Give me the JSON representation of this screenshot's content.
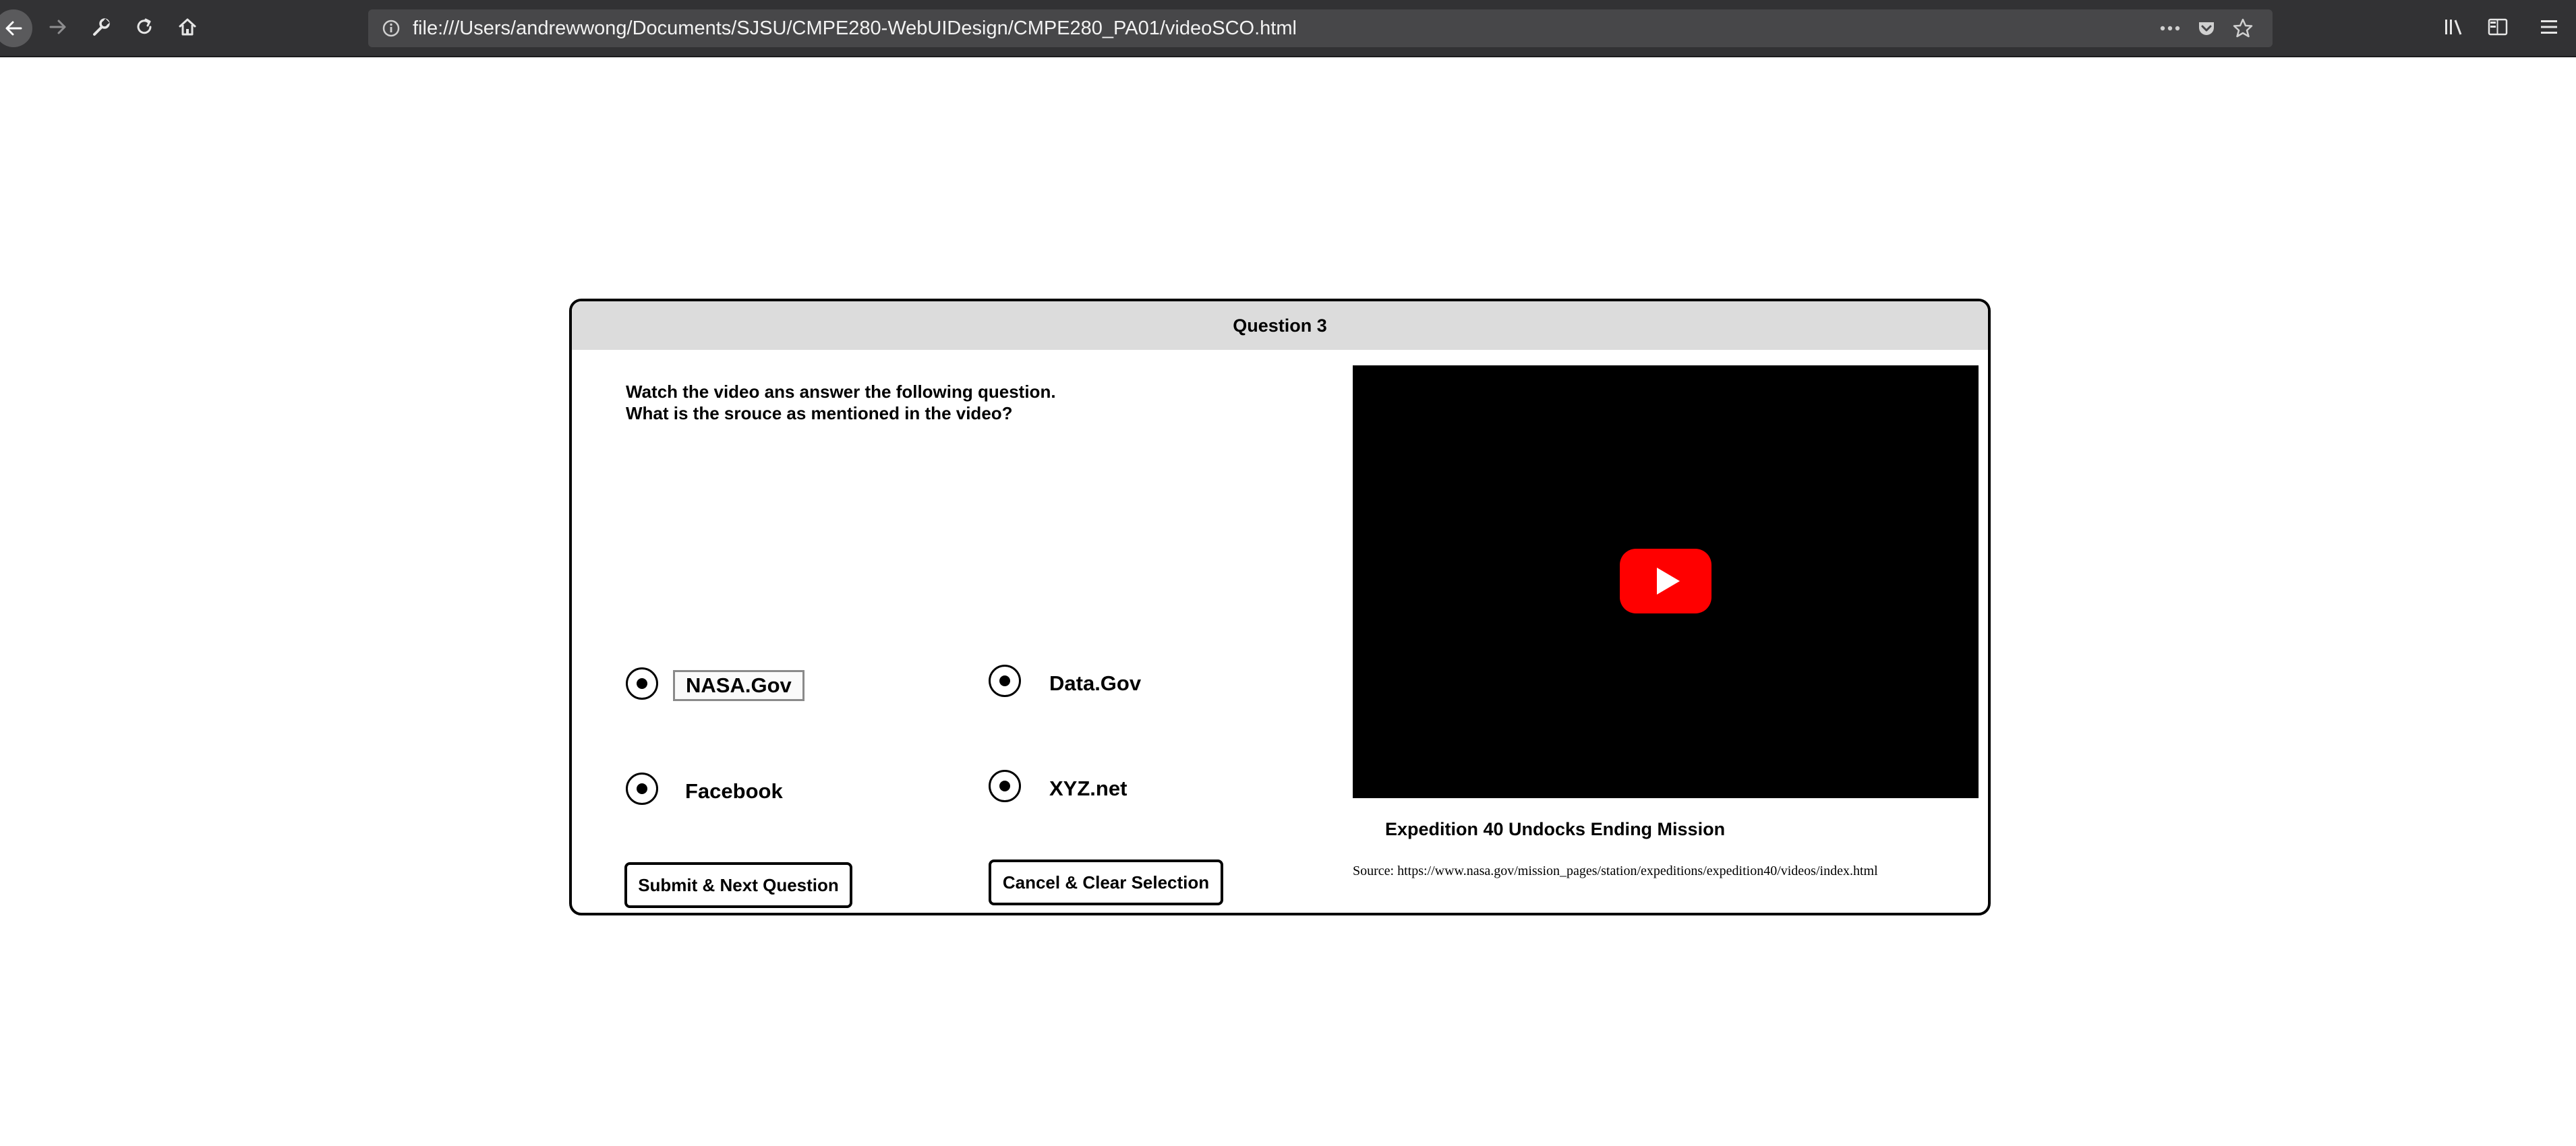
{
  "browser": {
    "url": "file:///Users/andrewwong/Documents/SJSU/CMPE280-WebUIDesign/CMPE280_PA01/videoSCO.html",
    "icons": {
      "back": "back-arrow-icon",
      "forward": "forward-arrow-icon",
      "tools": "wrench-icon",
      "reload": "reload-icon",
      "home": "home-icon",
      "info": "info-icon",
      "more": "more-actions-icon",
      "pocket": "pocket-icon",
      "bookmark": "star-icon",
      "library": "library-icon",
      "sidebar": "sidebar-icon",
      "menu": "hamburger-menu-icon"
    }
  },
  "question": {
    "header": "Question 3",
    "instruction_line1": "Watch the video ans answer the following question.",
    "instruction_line2": "What is the srouce as mentioned in the video?",
    "options": [
      {
        "label": "NASA.Gov"
      },
      {
        "label": "Data.Gov"
      },
      {
        "label": "Facebook"
      },
      {
        "label": "XYZ.net"
      }
    ],
    "submit_label": "Submit & Next Question",
    "cancel_label": "Cancel & Clear Selection"
  },
  "video": {
    "title": "Expedition 40 Undocks Ending Mission",
    "source": "Source: https://www.nasa.gov/mission_pages/station/expeditions/expedition40/videos/index.html",
    "play_color": "#ff0000",
    "play_icon": "youtube-play-icon"
  }
}
